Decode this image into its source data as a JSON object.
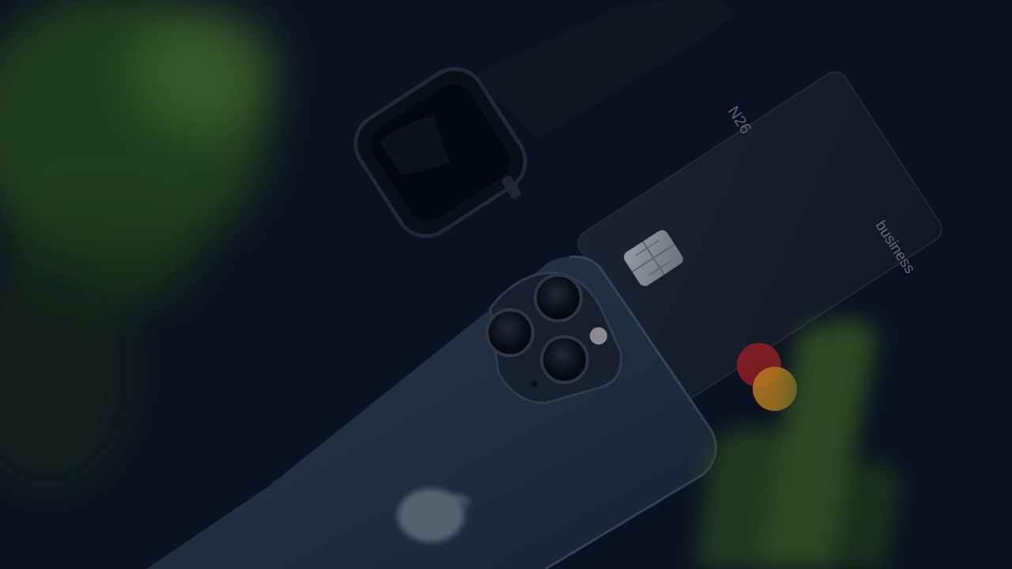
{
  "scene": {
    "card": {
      "brand": "N26",
      "tier": "business"
    },
    "colors": {
      "background": "#0b1220",
      "card": "#1a2130",
      "phone": "#2a3a4c",
      "watch": "#141c28",
      "mastercard_red": "#c0282a",
      "mastercard_orange": "#f0a226",
      "leaf": "#3f6a28"
    }
  }
}
